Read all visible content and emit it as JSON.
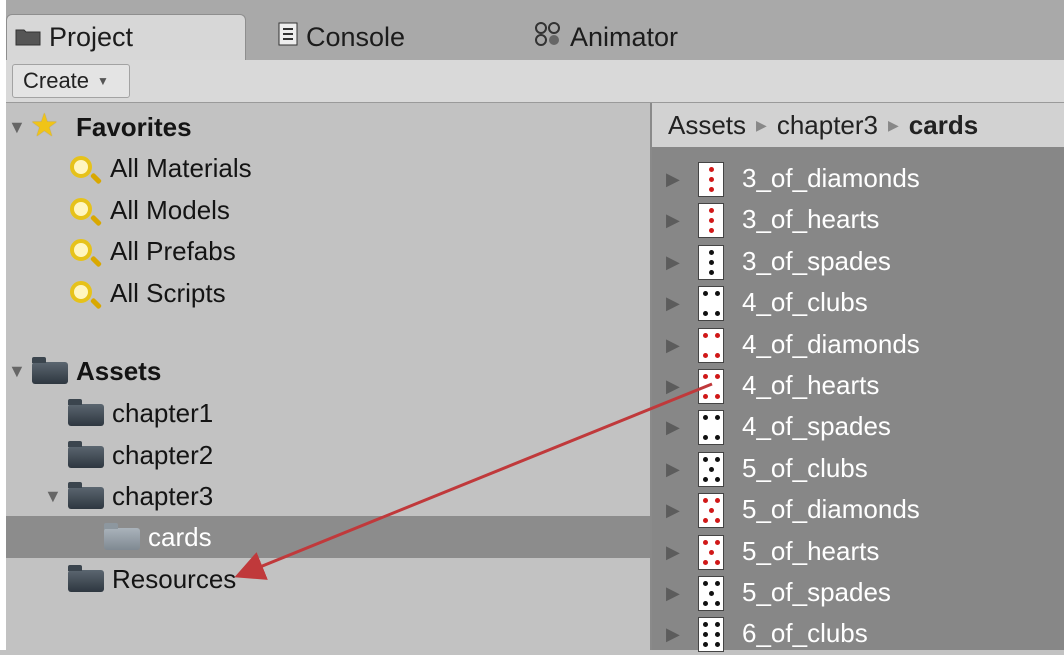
{
  "tabs": [
    {
      "label": "Project",
      "icon": "folder-icon",
      "active": true
    },
    {
      "label": "Console",
      "icon": "console-icon",
      "active": false
    },
    {
      "label": "Animator",
      "icon": "animator-icon",
      "active": false
    }
  ],
  "toolbar": {
    "create_label": "Create"
  },
  "favorites": {
    "label": "Favorites",
    "items": [
      "All Materials",
      "All Models",
      "All Prefabs",
      "All Scripts"
    ]
  },
  "assets": {
    "label": "Assets",
    "folders": [
      "chapter1",
      "chapter2",
      "chapter3",
      "cards",
      "Resources"
    ],
    "selected": "cards"
  },
  "breadcrumb": [
    "Assets",
    "chapter3",
    "cards"
  ],
  "files": [
    "3_of_diamonds",
    "3_of_hearts",
    "3_of_spades",
    "4_of_clubs",
    "4_of_diamonds",
    "4_of_hearts",
    "4_of_spades",
    "5_of_clubs",
    "5_of_diamonds",
    "5_of_hearts",
    "5_of_spades",
    "6_of_clubs"
  ],
  "colors": {
    "annotation": "#c0393b",
    "selection": "#8c8c8c",
    "panel": "#878787"
  }
}
